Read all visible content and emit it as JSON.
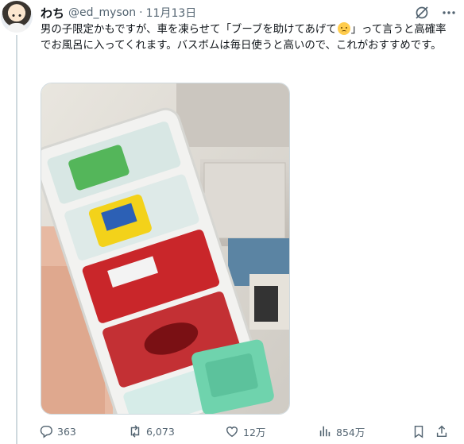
{
  "post": {
    "author_name": "わち",
    "handle": "@ed_myson",
    "separator": "·",
    "date": "11月13日",
    "text_before_emoji": "男の子限定かもですが、車を凍らせて「ブーブを助けてあげて",
    "emoji": "crying-face-emoji",
    "text_after_emoji": "」って言うと高確率でお風呂に入ってくれます。バスボムは毎日使うと高いので、これがおすすめです。"
  },
  "media": {
    "description_icon": "photo-ice-tray-toy-cars"
  },
  "actions": {
    "replies": "363",
    "reposts": "6,073",
    "likes": "12万",
    "views": "854万"
  },
  "colors": {
    "text": "#0f1419",
    "secondary": "#536471",
    "border": "#cfd9de"
  }
}
